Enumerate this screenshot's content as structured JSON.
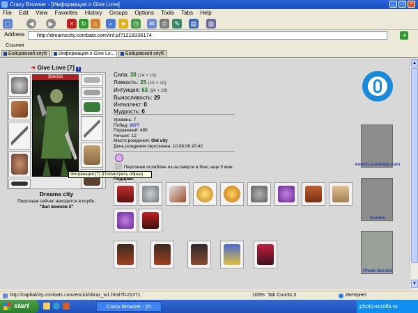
{
  "window": {
    "title": "Crazy Browser - [Информация о Give Love]",
    "controls": [
      "_",
      "□",
      "×"
    ]
  },
  "menu": [
    "File",
    "Edit",
    "View",
    "Favorites",
    "History",
    "Groups",
    "Options",
    "Tools",
    "Tabs",
    "Help"
  ],
  "address": {
    "label": "Address",
    "url": "http://dreamscity.combats.com/inf.pl?1218336174"
  },
  "links_label": "Ссылки",
  "tabs": [
    {
      "label": "Бойцовский клуб"
    },
    {
      "label": "Информация о Give Lo..."
    },
    {
      "label": "Бойцовский клуб"
    }
  ],
  "character": {
    "name": "Give Love",
    "level": "[7]",
    "hp_text": "356/356",
    "hp_fraction": 1.0,
    "city": "Dreams city",
    "location_text": "Персонаж сейчас находится в клубе.",
    "room": "\"Зал воинов 2\"",
    "tooltip": "Флоренция [7] (Посмотреть образ)"
  },
  "stats": [
    {
      "label": "Сила:",
      "value": "30",
      "extra": "(14 + 16)"
    },
    {
      "label": "Ловкость:",
      "value": "25",
      "extra": "(15 + 10)"
    },
    {
      "label": "Интуиция:",
      "value": "63",
      "extra": "(34 + 29)"
    },
    {
      "label": "Выносливость:",
      "value": "29",
      "extra": ""
    },
    {
      "label": "Интеллект:",
      "value": "0",
      "extra": ""
    },
    {
      "label": "Мудрость:",
      "value": "0",
      "extra": ""
    }
  ],
  "info": [
    {
      "label": "Уровень:",
      "value": "7"
    },
    {
      "label": "Побед:",
      "value": "2677"
    },
    {
      "label": "Поражений:",
      "value": "485"
    },
    {
      "label": "Ничьих:",
      "value": "12"
    },
    {
      "label": "Место рождения:",
      "value": "Old city"
    },
    {
      "label": "День рождения персонажа:",
      "value": "10.08.08 20:42"
    }
  ],
  "weakness_text": "Персонаж ослаблен из-за смерти в бою, еще 5 мин.",
  "gifts_label": "Подарки:",
  "right_links": {
    "events": "events.combats.com",
    "scrolls": "Scrolls",
    "photo": "Photo Scrolls"
  },
  "status": {
    "url": "http://capitalcity.combats.com/encicl/obraz_w1.html?l=21371",
    "zoom": "100%",
    "tab_count": "Tab Counts:3",
    "zone": "Интернет"
  },
  "taskbar": {
    "start": "start",
    "task": "Crazy Browser - [И...",
    "tray": "photo-scrolls.ru"
  },
  "colors": {
    "titlebar": "#1a4fc0",
    "stat_value": "#0a6f0a",
    "link": "#1f3aa8",
    "content_bg": "#d8d8d8"
  }
}
